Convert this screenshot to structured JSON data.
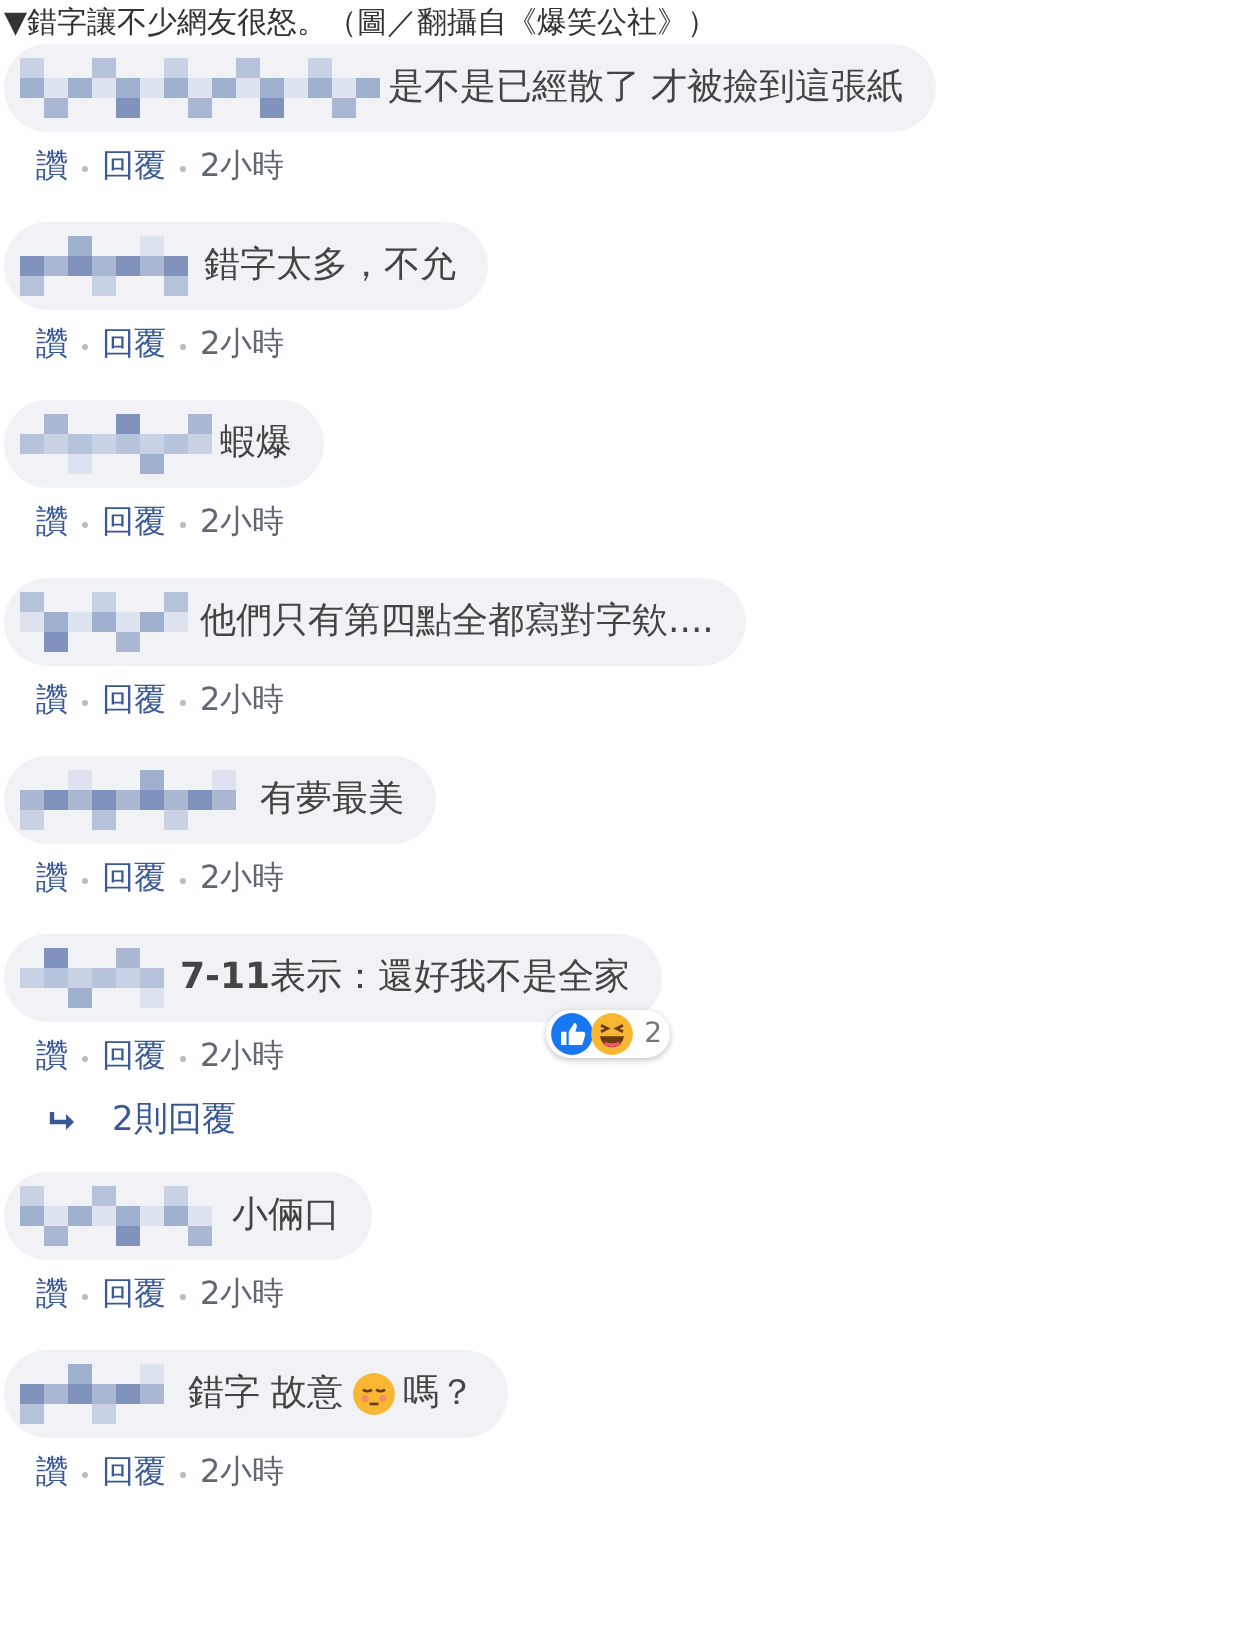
{
  "caption": "▼錯字讓不少網友很怒。（圖／翻攝自《爆笑公社》）",
  "comments": [
    {
      "text": "是不是已經散了 才被撿到這張紙",
      "actions": [
        "讚",
        "回覆",
        "2小時"
      ]
    },
    {
      "text": "錯字太多，不允",
      "actions": [
        "讚",
        "回覆",
        "2小時"
      ]
    },
    {
      "text": "蝦爆",
      "actions": [
        "讚",
        "回覆",
        "2小時"
      ]
    },
    {
      "text": "他們只有第四點全都寫對字欸....",
      "actions": [
        "讚",
        "回覆",
        "2小時"
      ]
    },
    {
      "text": "有夢最美",
      "actions": [
        "讚",
        "回覆",
        "2小時"
      ]
    },
    {
      "text": "**7-11**表示：還好我不是全家",
      "reactions": {
        "count": "2"
      },
      "actions": [
        "讚",
        "回覆",
        "2小時"
      ],
      "replies": "2則回覆"
    },
    {
      "text": "小倆口",
      "actions": [
        "讚",
        "回覆",
        "2小時"
      ]
    },
    {
      "text": "錯字 故意",
      "text_after_emoji": "嗎？",
      "actions": [
        "讚",
        "回覆",
        "2小時"
      ]
    }
  ]
}
